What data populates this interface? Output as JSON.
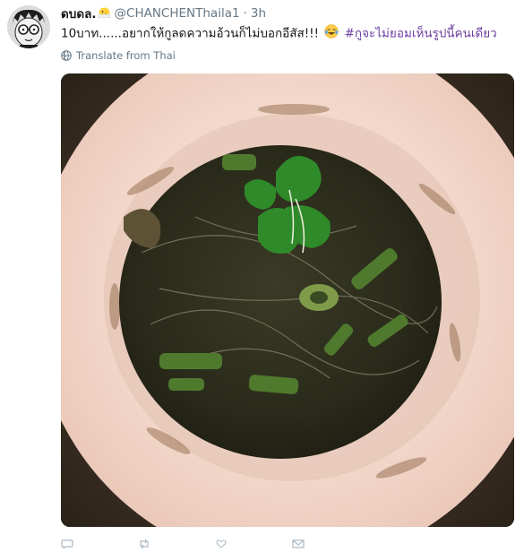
{
  "tweet": {
    "display_name": "ดบดล.",
    "handle": "@CHANCHENThaila1",
    "separator": "·",
    "time": "3h",
    "text_main": "10บาท......อยากให้กูลดความอ้วนก็ไม่บอกอีสัส!!!",
    "hashtag": "#กูจะไม่ยอมเห็นรูปนี้คนเดียว",
    "translate_label": "Translate from Thai"
  },
  "icons": {
    "avatar": "cartoon-glasses-avatar",
    "name_badge": "hatching-chick-icon",
    "emoji": "tears-of-joy-emoji",
    "translate": "globe-icon",
    "actions": [
      "reply-icon",
      "retweet-icon",
      "like-icon",
      "message-icon"
    ]
  },
  "colors": {
    "hashtag": "#6a3ea0",
    "muted": "#657786"
  }
}
